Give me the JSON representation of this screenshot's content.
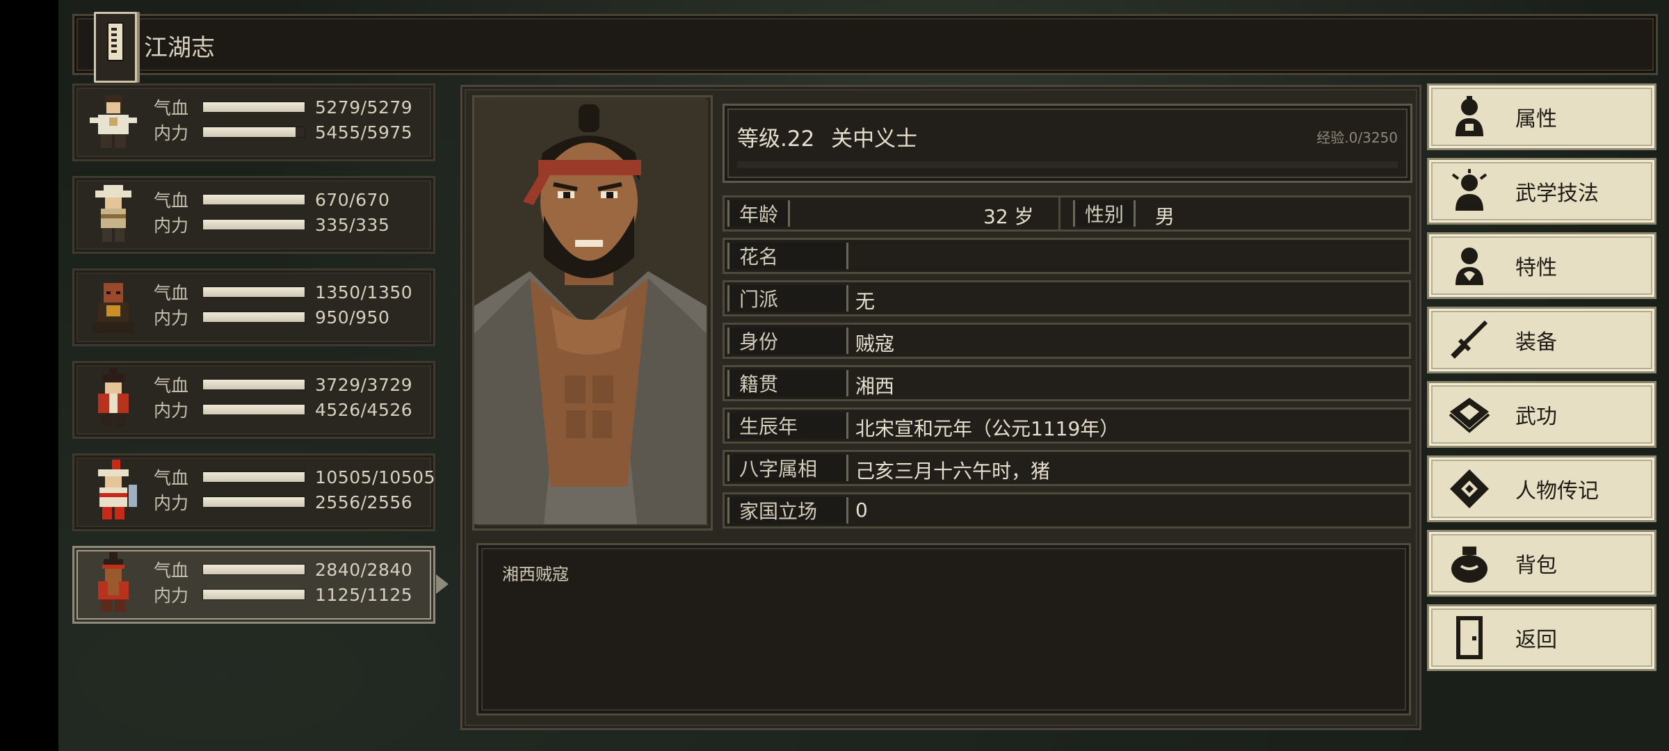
{
  "header": {
    "title": "江湖志",
    "icon": "book-icon"
  },
  "party": [
    {
      "hp_label": "气血",
      "mp_label": "内力",
      "hp": "5279/5279",
      "mp": "5455/5975",
      "hp_frac": 1.0,
      "mp_frac": 0.913,
      "sprite": "wuxia-hero-sprite",
      "selected": false
    },
    {
      "hp_label": "气血",
      "mp_label": "内力",
      "hp": "670/670",
      "mp": "335/335",
      "hp_frac": 1.0,
      "mp_frac": 1.0,
      "sprite": "straw-hat-sprite",
      "selected": false
    },
    {
      "hp_label": "气血",
      "mp_label": "内力",
      "hp": "1350/1350",
      "mp": "950/950",
      "hp_frac": 1.0,
      "mp_frac": 1.0,
      "sprite": "monk-sprite",
      "selected": false
    },
    {
      "hp_label": "气血",
      "mp_label": "内力",
      "hp": "3729/3729",
      "mp": "4526/4526",
      "hp_frac": 1.0,
      "mp_frac": 1.0,
      "sprite": "official-sprite",
      "selected": false
    },
    {
      "hp_label": "气血",
      "mp_label": "内力",
      "hp": "10505/10505",
      "mp": "2556/2556",
      "hp_frac": 1.0,
      "mp_frac": 1.0,
      "sprite": "red-plume-sprite",
      "selected": false
    },
    {
      "hp_label": "气血",
      "mp_label": "内力",
      "hp": "2840/2840",
      "mp": "1125/1125",
      "hp_frac": 1.0,
      "mp_frac": 1.0,
      "sprite": "bandit-sprite",
      "selected": true
    }
  ],
  "character": {
    "level": "等级.22",
    "title": "关中义士",
    "exp": "经验.0/3250",
    "exp_frac": 0.0,
    "age_label": "年龄",
    "age": "32 岁",
    "gender_label": "性别",
    "gender": "男",
    "nickname_label": "花名",
    "nickname": "",
    "sect_label": "门派",
    "sect": "无",
    "identity_label": "身份",
    "identity": "贼寇",
    "origin_label": "籍贯",
    "origin": "湘西",
    "birth_label": "生辰年",
    "birth": "北宋宣和元年（公元1119年）",
    "bazi_label": "八字属相",
    "bazi": "己亥三月十六午时，猪",
    "stance_label": "家国立场",
    "stance": "0",
    "description": "湘西贼寇"
  },
  "menu": [
    {
      "label": "属性",
      "icon": "attribute-person-icon"
    },
    {
      "label": "武学技法",
      "icon": "skills-person-icon"
    },
    {
      "label": "特性",
      "icon": "trait-person-icon"
    },
    {
      "label": "装备",
      "icon": "sword-icon"
    },
    {
      "label": "武功",
      "icon": "martial-book-icon"
    },
    {
      "label": "人物传记",
      "icon": "biography-scroll-icon"
    },
    {
      "label": "背包",
      "icon": "bag-icon"
    },
    {
      "label": "返回",
      "icon": "door-icon"
    }
  ]
}
